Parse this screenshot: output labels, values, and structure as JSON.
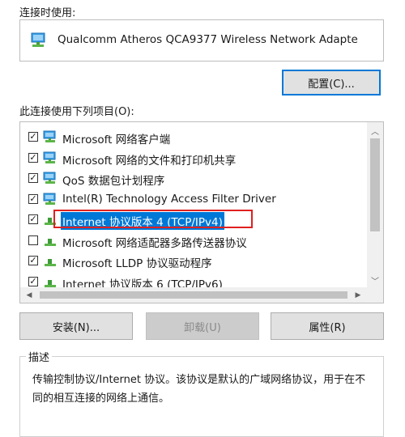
{
  "connect_using_label": "连接时使用:",
  "adapter": {
    "name": "Qualcomm Atheros QCA9377 Wireless Network Adapte",
    "icon": "network-adapter-icon"
  },
  "configure_button": "配置(C)...",
  "items_label": "此连接使用下列项目(O):",
  "items": [
    {
      "checked": true,
      "checkmark": "✓",
      "label": "Microsoft 网络客户端",
      "icon": "network-client-icon"
    },
    {
      "checked": true,
      "checkmark": "✓",
      "label": "Microsoft 网络的文件和打印机共享",
      "icon": "network-service-icon"
    },
    {
      "checked": true,
      "checkmark": "✓",
      "label": "QoS 数据包计划程序",
      "icon": "network-service-icon"
    },
    {
      "checked": true,
      "checkmark": "✓",
      "label": "Intel(R) Technology Access Filter Driver",
      "icon": "network-service-icon"
    },
    {
      "checked": true,
      "checkmark": "✓",
      "label": "Internet 协议版本 4 (TCP/IPv4)",
      "icon": "protocol-icon",
      "selected": true
    },
    {
      "checked": false,
      "checkmark": "",
      "label": "Microsoft 网络适配器多路传送器协议",
      "icon": "protocol-icon"
    },
    {
      "checked": true,
      "checkmark": "✓",
      "label": "Microsoft LLDP 协议驱动程序",
      "icon": "protocol-icon"
    },
    {
      "checked": true,
      "checkmark": "✓",
      "label": "Internet 协议版本 6 (TCP/IPv6)",
      "icon": "protocol-icon"
    }
  ],
  "buttons": {
    "install": "安装(N)...",
    "uninstall": "卸载(U)",
    "properties": "属性(R)"
  },
  "description": {
    "title": "描述",
    "text": "传输控制协议/Internet 协议。该协议是默认的广域网络协议，用于在不同的相互连接的网络上通信。"
  },
  "colors": {
    "selection": "#0078d7",
    "highlight_border": "#e02020",
    "accent": "#0078d7"
  }
}
